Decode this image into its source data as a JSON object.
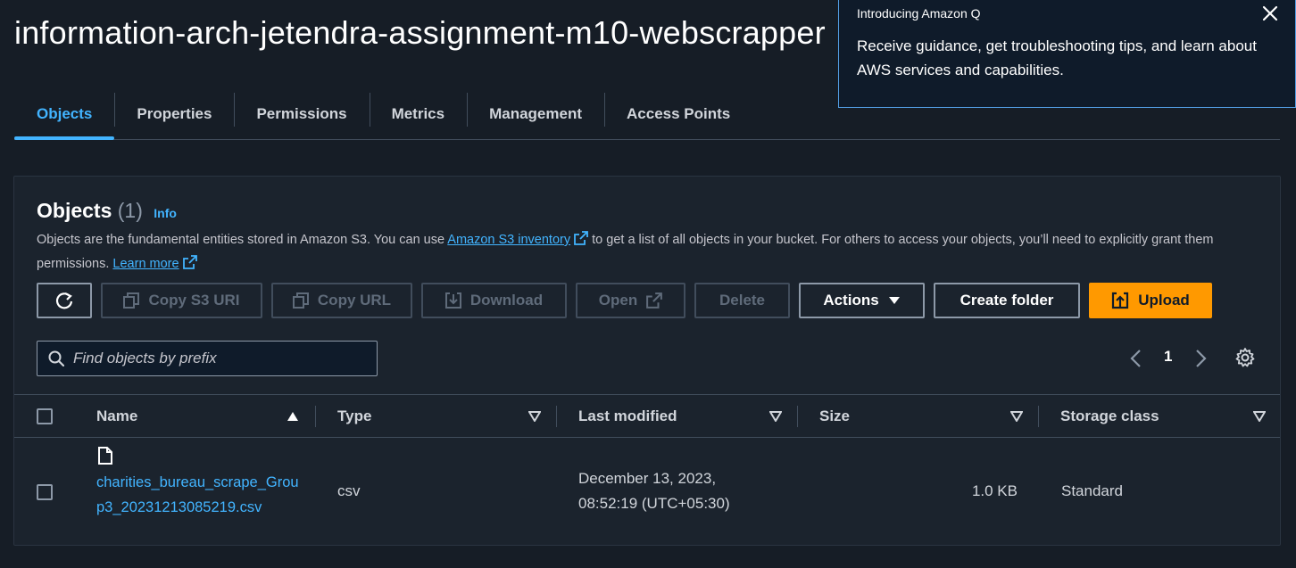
{
  "bucket": {
    "name": "information-arch-jetendra-assignment-m10-webscrapper"
  },
  "tabs": [
    "Objects",
    "Properties",
    "Permissions",
    "Metrics",
    "Management",
    "Access Points"
  ],
  "amazon_q": {
    "title": "Introducing Amazon Q",
    "body": "Receive guidance, get troubleshooting tips, and learn about AWS services and capabilities."
  },
  "objects_panel": {
    "title": "Objects",
    "count": "(1)",
    "info_label": "Info",
    "desc_part1": "Objects are the fundamental entities stored in Amazon S3. You can use ",
    "inventory_link": "Amazon S3 inventory",
    "desc_part2": " to get a list of all objects in your bucket. For others to access your objects, you’ll need to explicitly grant them permissions. ",
    "learn_more": "Learn more"
  },
  "toolbar": {
    "copy_s3_uri": "Copy S3 URI",
    "copy_url": "Copy URL",
    "download": "Download",
    "open": "Open",
    "delete": "Delete",
    "actions": "Actions",
    "create_folder": "Create folder",
    "upload": "Upload"
  },
  "search": {
    "placeholder": "Find objects by prefix"
  },
  "pagination": {
    "current_page": "1"
  },
  "table": {
    "columns": [
      "Name",
      "Type",
      "Last modified",
      "Size",
      "Storage class"
    ],
    "rows": [
      {
        "name": "charities_bureau_scrape_Group3_20231213085219.csv",
        "type": "csv",
        "last_modified_line1": "December 13, 2023,",
        "last_modified_line2": "08:52:19 (UTC+05:30)",
        "size": "1.0 KB",
        "storage_class": "Standard"
      }
    ]
  },
  "colors": {
    "accent": "#42b4ff",
    "primary": "#ff9900",
    "background": "#161d26"
  }
}
